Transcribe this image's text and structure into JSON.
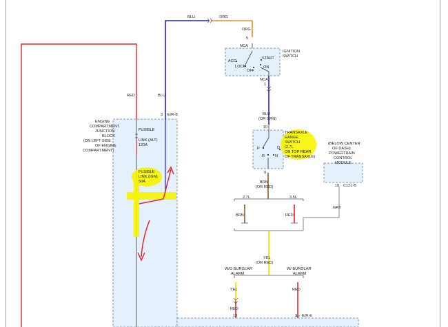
{
  "labels": {
    "blu_top": "BLU",
    "org_top": "ORG",
    "org": "ORG",
    "pin5": "5",
    "nca_top": "NCA",
    "nca_bottom": "NCA",
    "pin1": "1",
    "blu_mid": "BLU",
    "or_grn": "(OR GRN)",
    "pin10": "10",
    "pin9": "9",
    "brn": "BRN",
    "or_red": "(OR RED)",
    "l27": "2.7L",
    "l35": "3.5L",
    "red": "RED",
    "gry": "GRY",
    "pin18": "18",
    "c121b": "C121-B",
    "yel": "YEL",
    "pin13": "13",
    "pin3b": "3",
    "ere": "E/R-E",
    "pin3": "3",
    "erb": "E/R-B"
  },
  "ignition": {
    "title1": "IGNITION",
    "title2": "SWITCH",
    "acc": "ACC",
    "lock": "LOCK",
    "off": "OFF",
    "on": "ON",
    "start": "START"
  },
  "transaxle": {
    "t1": "TRANSAXLE",
    "t2": "RANGE",
    "t3": "SWITCH",
    "t4": "(2.7L",
    "t5": "ON TOP REAR",
    "t6": "OF TRANSAXLE)",
    "p": "P",
    "r": "R",
    "n": "N",
    "d": "D"
  },
  "pcm": {
    "p1": "(BELOW CENTER",
    "p2": "OF DASH)",
    "p3": "POWERTRAIN",
    "p4": "CONTROL",
    "p5": "MODULE"
  },
  "alarm": {
    "wo1": "W/O BURGLAR",
    "wo2": "ALARM",
    "w1": "W/ BURGLAR",
    "w2": "ALARM"
  },
  "junction": {
    "j1": "ENGINE",
    "j2": "COMPARTMENT",
    "j3": "JUNCTION",
    "j4": "BLOCK",
    "j5": "(ON LEFT SIDE",
    "j6": "OF ENGINE",
    "j7": "COMPARTMENT)"
  },
  "fusible": {
    "alt1": "FUSIBLE",
    "alt2": "LINK (ALT)",
    "alt3": "120A",
    "ign1": "FUSIBLE",
    "ign2": "LINK (IGN)",
    "ign3": "50A"
  },
  "colors": {
    "red_wire": "#e8232b",
    "blue_wire": "#2222dd",
    "orange_wire": "#f08c2a",
    "brown_wire": "#8a5a2a",
    "yellow_wire": "#f4e400",
    "gray_wire": "#9a9a9a",
    "highlight": "#f6f400",
    "panel_fill": "#e4f0fb"
  }
}
